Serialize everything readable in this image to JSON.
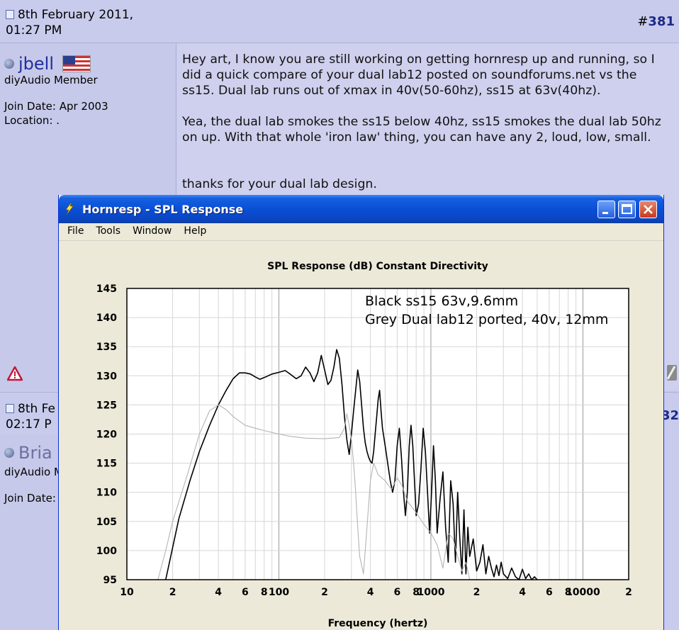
{
  "post1": {
    "date": "8th February 2011,\n01:27 PM",
    "number": "381",
    "user": {
      "name": "jbell",
      "title": "diyAudio Member",
      "join": "Join Date: Apr 2003",
      "location": "Location: ."
    },
    "paragraphs": [
      "Hey art, I know you are still working on getting hornresp up and running, so I did a quick compare of your dual lab12 posted on soundforums.net vs the ss15. Dual lab runs out of xmax in 40v(50-60hz), ss15 at 63v(40hz).",
      "Yea, the dual lab smokes the ss15 below 40hz, ss15 smokes the dual lab 50hz on up. With that whole 'iron law' thing, you can have any 2, loud, low, small.",
      "thanks for your dual lab design."
    ]
  },
  "post2": {
    "date": "8th Fe\n02:17 P",
    "number": "32",
    "user": {
      "name": "Bria",
      "title": "diyAudio M",
      "join": "Join Date:"
    }
  },
  "window": {
    "title": "Hornresp - SPL Response",
    "menu": [
      "File",
      "Tools",
      "Window",
      "Help"
    ]
  },
  "colors": {
    "black_series": "#000000",
    "grey_series": "#b4b4b4",
    "xp_title": "#0a4fd6"
  },
  "chart_data": {
    "type": "line",
    "title": "SPL Response (dB)   Constant Directivity",
    "xlabel": "Frequency (hertz)",
    "ylabel": "",
    "x_scale": "log",
    "xlim": [
      10,
      20000
    ],
    "ylim": [
      95,
      145
    ],
    "y_ticks": [
      "145",
      "140",
      "135",
      "130",
      "125",
      "120",
      "115",
      "110",
      "105",
      "100",
      "95"
    ],
    "x_ticks": [
      "10",
      "2",
      "4",
      "6",
      "8",
      "100",
      "2",
      "4",
      "6",
      "8",
      "1000",
      "2",
      "4",
      "6",
      "8",
      "10000",
      "2"
    ],
    "grid": true,
    "annotations": [
      "Black ss15 63v,9.6mm",
      "Grey Dual lab12 ported, 40v, 12mm"
    ],
    "series": [
      {
        "color": "#000000",
        "x": [
          18,
          22,
          26,
          30,
          35,
          40,
          45,
          50,
          55,
          60,
          65,
          70,
          75,
          80,
          90,
          100,
          110,
          120,
          130,
          140,
          150,
          160,
          170,
          180,
          190,
          200,
          210,
          220,
          230,
          240,
          250,
          260,
          270,
          280,
          290,
          300,
          310,
          320,
          330,
          340,
          350,
          360,
          370,
          380,
          390,
          400,
          410,
          420,
          430,
          440,
          450,
          460,
          470,
          480,
          500,
          520,
          540,
          560,
          580,
          600,
          620,
          640,
          660,
          680,
          700,
          720,
          740,
          760,
          780,
          800,
          830,
          860,
          890,
          920,
          950,
          980,
          1010,
          1040,
          1070,
          1100,
          1150,
          1200,
          1250,
          1300,
          1350,
          1400,
          1450,
          1500,
          1550,
          1600,
          1650,
          1700,
          1750,
          1800,
          1900,
          2000,
          2100,
          2200,
          2300,
          2400,
          2500,
          2600,
          2700,
          2800,
          2900,
          3000,
          3200,
          3400,
          3600,
          3800,
          4000,
          4200,
          4400,
          4600,
          4800,
          5000
        ],
        "y": [
          95,
          105.5,
          112,
          117,
          121.5,
          125,
          127.5,
          129.5,
          130.5,
          130.5,
          130.3,
          129.8,
          129.4,
          129.7,
          130.3,
          130.6,
          130.9,
          130.2,
          129.5,
          130,
          131.5,
          130.5,
          129,
          130.5,
          133.5,
          131,
          128.5,
          129.2,
          131.5,
          134.5,
          133,
          128.5,
          123,
          119,
          116.5,
          120,
          124,
          127.5,
          131,
          129,
          125,
          121,
          118.5,
          117,
          116,
          115.3,
          115,
          117,
          120,
          123,
          126,
          127.5,
          124,
          121,
          118,
          115,
          112,
          110,
          112,
          118,
          121,
          116,
          110,
          106,
          110,
          118,
          121.5,
          118,
          112,
          106,
          108,
          114,
          121,
          117,
          110,
          103,
          110,
          118,
          112,
          103,
          109,
          113.5,
          104,
          98,
          112,
          108,
          98,
          110,
          102,
          96,
          107,
          96,
          104,
          99,
          102,
          96.5,
          98,
          101,
          96,
          99,
          97,
          95.5,
          97.5,
          95.7,
          98,
          96,
          95.2,
          97,
          95.5,
          95,
          96.8,
          95.2,
          96,
          95,
          95.5,
          95
        ]
      },
      {
        "color": "#b4b4b4",
        "x": [
          16,
          18,
          20,
          25,
          30,
          35,
          40,
          45,
          50,
          60,
          70,
          80,
          100,
          120,
          150,
          200,
          250,
          270,
          280,
          290,
          300,
          310,
          320,
          330,
          340,
          360,
          380,
          400,
          420,
          450,
          500,
          550,
          600,
          650,
          700,
          800,
          900,
          1000,
          1100,
          1200,
          1300,
          1400,
          1500,
          1600,
          1700,
          1800
        ],
        "y": [
          95,
          100,
          105,
          113,
          120,
          124,
          125,
          124.2,
          123,
          121.5,
          121,
          120.6,
          120,
          119.6,
          119.3,
          119.2,
          119.4,
          121,
          123.5,
          121.5,
          119,
          115,
          110,
          104,
          99,
          96,
          104,
          112,
          115,
          113,
          112,
          110.5,
          112.5,
          111,
          108.5,
          106.5,
          104.5,
          103,
          101,
          97,
          103,
          102,
          99,
          96.5,
          98,
          95
        ]
      }
    ]
  }
}
